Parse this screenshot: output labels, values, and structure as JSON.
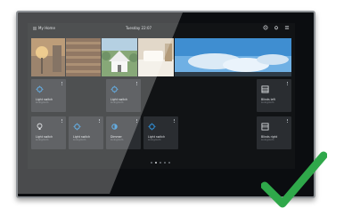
{
  "topbar": {
    "home_title": "My Home",
    "datetime": "Tuesday 22:07"
  },
  "tiles": [
    {
      "name": "Light switch",
      "room": "Livingroom",
      "icon": "light-icon"
    },
    {
      "name": "Light switch",
      "room": "Livingroom",
      "icon": "light-icon"
    },
    {
      "name": "Blinds left",
      "room": "Livingroom",
      "icon": "blinds-icon"
    },
    {
      "name": "Light switch",
      "room": "Livingroom",
      "icon": "bulb-icon"
    },
    {
      "name": "Light switch",
      "room": "Livingroom",
      "icon": "light-icon"
    },
    {
      "name": "Dimmer",
      "room": "Livingroom",
      "icon": "dimmer-icon"
    },
    {
      "name": "Light switch",
      "room": "Livingroom",
      "icon": "light-icon"
    },
    {
      "name": "Blinds right",
      "room": "Livingroom",
      "icon": "blinds-icon"
    }
  ],
  "pager": {
    "pages": 5,
    "active": 1
  },
  "colors": {
    "screen_bg": "#111315",
    "tile_bg": "#2a2d31",
    "accent_blue": "#2f8fd6",
    "check_green": "#2fa84a"
  }
}
